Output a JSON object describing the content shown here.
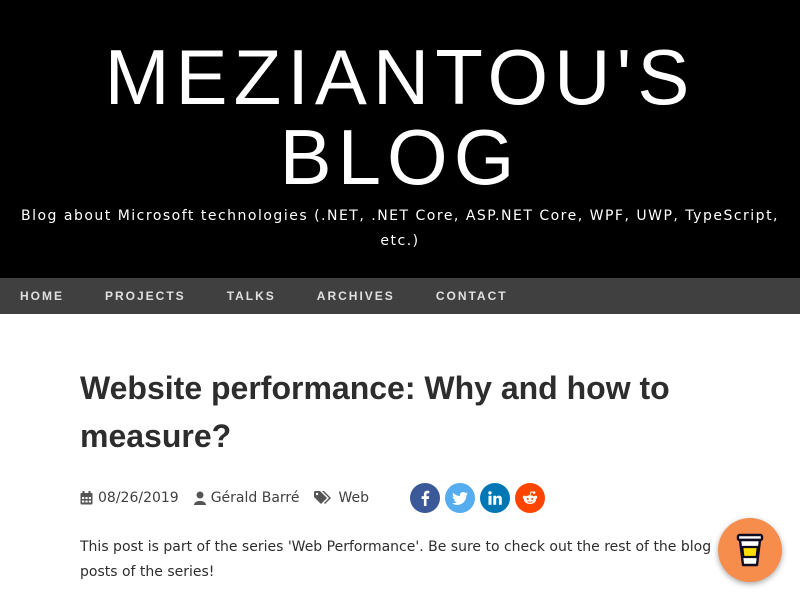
{
  "header": {
    "title_line1": "MEZIANTOU'S",
    "title_line2": "BLOG",
    "tagline": "Blog about Microsoft technologies (.NET, .NET Core, ASP.NET Core, WPF, UWP, TypeScript, etc.)"
  },
  "nav": {
    "items": [
      {
        "label": "HOME"
      },
      {
        "label": "PROJECTS"
      },
      {
        "label": "TALKS"
      },
      {
        "label": "ARCHIVES"
      },
      {
        "label": "CONTACT"
      }
    ]
  },
  "post": {
    "title": "Website performance: Why and how to measure?",
    "date": "08/26/2019",
    "author": "Gérald Barré",
    "tag": "Web",
    "intro": "This post is part of the series 'Web Performance'. Be sure to check out the rest of the blog posts of the series!"
  },
  "share": {
    "buttons": [
      {
        "icon": "facebook-icon",
        "color": "#3b5998",
        "glyph": "f"
      },
      {
        "icon": "twitter-icon",
        "color": "#55acee",
        "glyph": ""
      },
      {
        "icon": "linkedin-icon",
        "color": "#0077b5",
        "glyph": "in"
      },
      {
        "icon": "reddit-icon",
        "color": "#ff4500",
        "glyph": ""
      }
    ]
  },
  "widgets": {
    "coffee_button": {
      "icon": "coffee-cup-icon",
      "color": "#f68d4c"
    }
  }
}
